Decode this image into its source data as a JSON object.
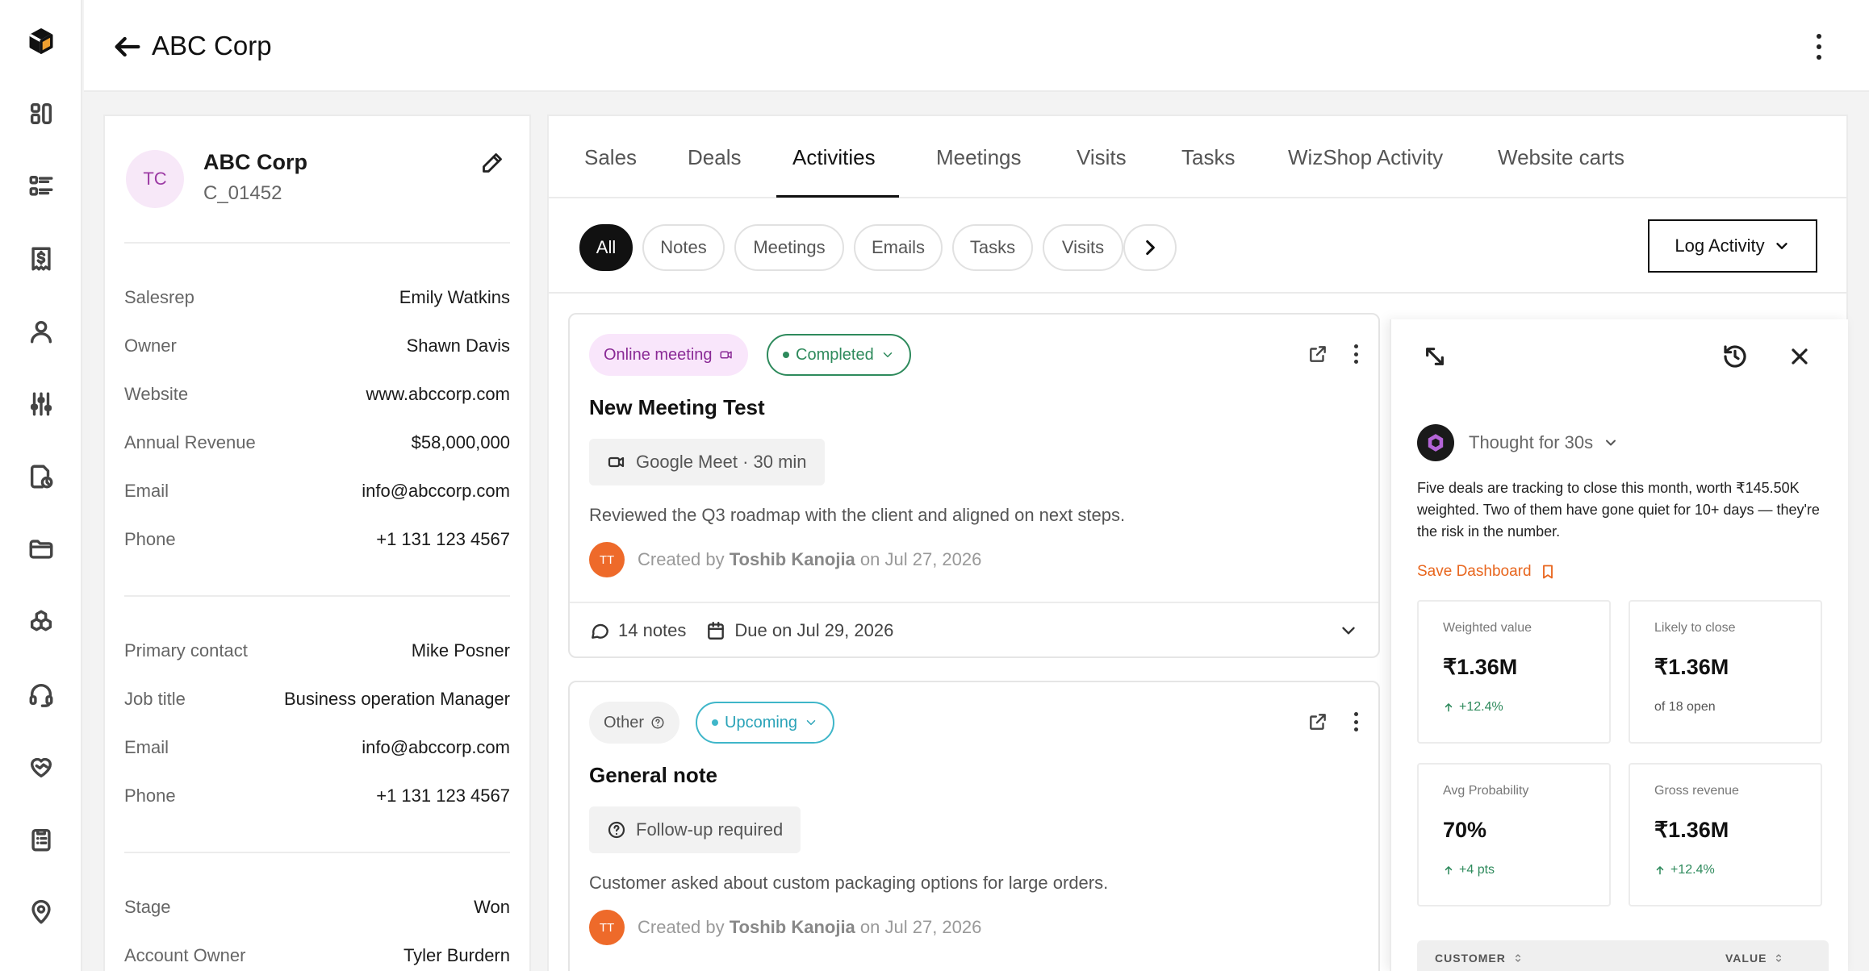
{
  "header": {
    "title": "ABC Corp"
  },
  "account": {
    "initials": "TC",
    "name": "ABC Corp",
    "code": "C_01452",
    "details": [
      {
        "label": "Salesrep",
        "value": "Emily Watkins"
      },
      {
        "label": "Owner",
        "value": "Shawn Davis"
      },
      {
        "label": "Website",
        "value": "www.abccorp.com"
      },
      {
        "label": "Annual Revenue",
        "value": "$58,000,000"
      },
      {
        "label": "Email",
        "value": "info@abccorp.com"
      },
      {
        "label": "Phone",
        "value": "+1 131 123 4567"
      }
    ],
    "contact": [
      {
        "label": "Primary contact",
        "value": "Mike Posner"
      },
      {
        "label": "Job title",
        "value": "Business operation Manager"
      },
      {
        "label": "Email",
        "value": "info@abccorp.com"
      },
      {
        "label": "Phone",
        "value": "+1 131 123 4567"
      }
    ],
    "stage": [
      {
        "label": "Stage",
        "value": "Won"
      },
      {
        "label": "Account Owner",
        "value": "Tyler Burdern"
      }
    ]
  },
  "tabs": [
    "Sales",
    "Deals",
    "Activities",
    "Meetings",
    "Visits",
    "Tasks",
    "WizShop Activity",
    "Website carts"
  ],
  "active_tab": "Activities",
  "filters": [
    "All",
    "Notes",
    "Meetings",
    "Emails",
    "Tasks",
    "Visits"
  ],
  "active_filter": "All",
  "log_activity_label": "Log Activity",
  "activities": [
    {
      "type": "Online meeting",
      "status": "Completed",
      "title": "New Meeting Test",
      "meta": "Google Meet · 30 min",
      "description": "Reviewed the Q3 roadmap with the client and aligned on next steps.",
      "creator_initials": "TT",
      "created_prefix": "Created by",
      "creator": "Toshib Kanojia",
      "created_suffix": "on Jul 27, 2026",
      "notes": "14 notes",
      "due": "Due on Jul 29, 2026"
    },
    {
      "type": "Other",
      "status": "Upcoming",
      "title": "General note",
      "meta": "Follow-up required",
      "description": "Customer asked about custom packaging options for large orders.",
      "creator_initials": "TT",
      "created_prefix": "Created by",
      "creator": "Toshib Kanojia",
      "created_suffix": "on Jul 27, 2026"
    }
  ],
  "ai_panel": {
    "thought": "Thought for 30s",
    "summary": "Five deals are tracking to close this month, worth ₹145.50K weighted. Two of them have gone quiet for 10+ days — they're the risk in the number.",
    "save_label": "Save Dashboard",
    "metrics": [
      {
        "label": "Weighted value",
        "value": "₹1.36M",
        "delta": "+12.4%"
      },
      {
        "label": "Likely to close",
        "value": "₹1.36M",
        "delta": "of 18 open"
      },
      {
        "label": "Avg Probability",
        "value": "70%",
        "delta": "+4 pts"
      },
      {
        "label": "Gross revenue",
        "value": "₹1.36M",
        "delta": "+12.4%"
      }
    ],
    "table_headers": [
      "CUSTOMER",
      "VALUE"
    ]
  },
  "colors": {
    "accent_orange": "#e8661e",
    "status_green": "#2e8a5c",
    "status_teal": "#3fb6c9",
    "tag_purple": "#8a2a96",
    "avatar_orange": "#ee6a2a"
  }
}
